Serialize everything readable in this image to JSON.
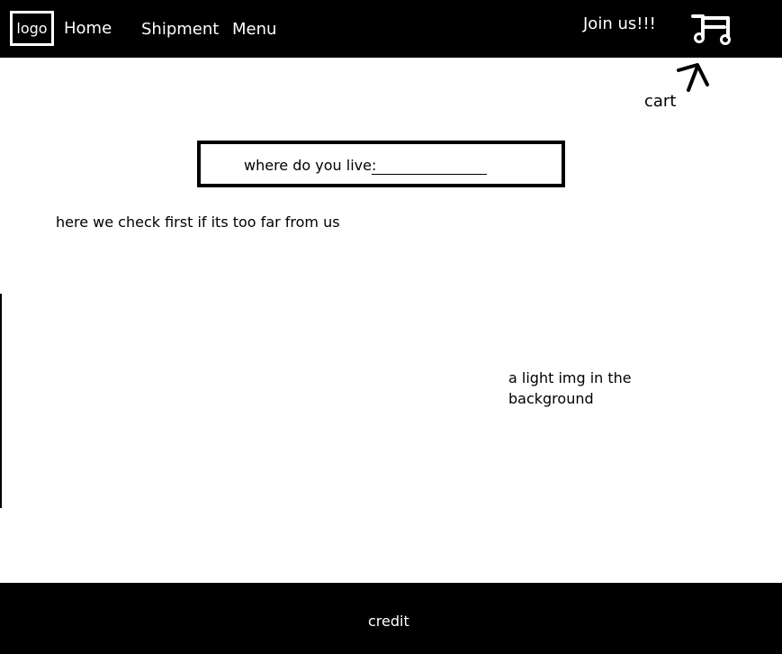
{
  "nav": {
    "logo_text": "logo",
    "links": {
      "home": "Home",
      "shipment": "Shipment",
      "menu": "Menu"
    },
    "join_label": "Join us!!!",
    "cart_icon": "cart-icon"
  },
  "annotations": {
    "cart_note": "cart",
    "check_note": "here we check first if its too far from us",
    "background_note": "a light img in the background"
  },
  "location": {
    "label": "where do you live:",
    "value": ""
  },
  "footer": {
    "credit": "credit"
  },
  "colors": {
    "bar": "#000000",
    "bar_text": "#ffffff",
    "page": "#ffffff",
    "text": "#000000"
  }
}
